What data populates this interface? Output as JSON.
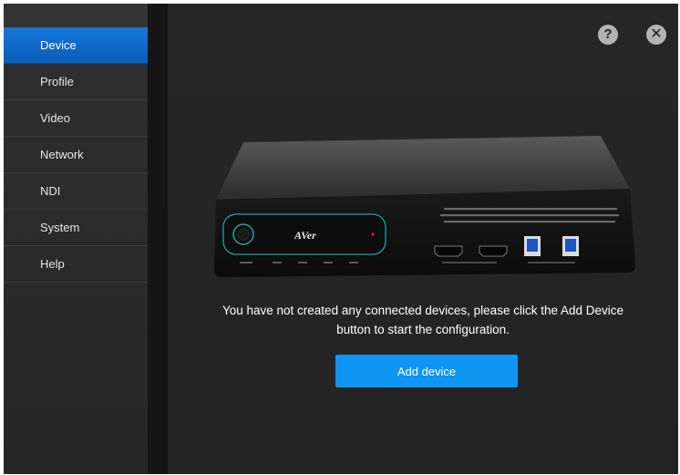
{
  "sidebar": {
    "items": [
      {
        "label": "Device",
        "active": true
      },
      {
        "label": "Profile"
      },
      {
        "label": "Video"
      },
      {
        "label": "Network"
      },
      {
        "label": "NDI"
      },
      {
        "label": "System"
      },
      {
        "label": "Help"
      }
    ]
  },
  "toolbar": {
    "help_icon": "?",
    "close_icon": "✕"
  },
  "device": {
    "brand": "AVer"
  },
  "main": {
    "message_line1": "You have not created any connected devices, please click the Add Device",
    "message_line2": "button to start the configuration.",
    "add_button_label": "Add device"
  },
  "colors": {
    "accent": "#0f95f2",
    "active_nav": "#1676d9",
    "background": "#1f1f1f"
  }
}
